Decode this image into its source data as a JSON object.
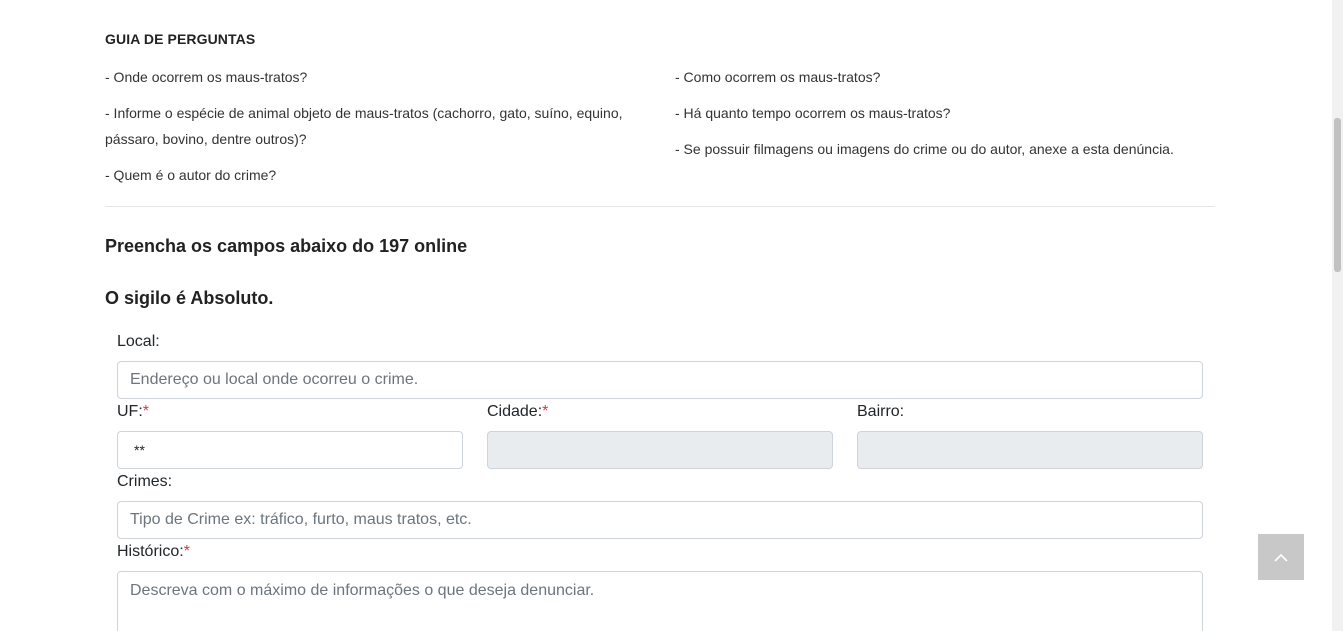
{
  "guide": {
    "title": "GUIA DE PERGUNTAS",
    "left": [
      "- Onde ocorrem os maus-tratos?",
      "- Informe o espécie de animal objeto de maus-tratos (cachorro, gato, suíno, equino, pássaro, bovino, dentre outros)?",
      "- Quem é o autor do crime?"
    ],
    "right": [
      "- Como ocorrem os maus-tratos?",
      "- Há quanto tempo ocorrem os maus-tratos?",
      "- Se possuir filmagens ou imagens do crime ou do autor, anexe a esta denúncia."
    ]
  },
  "headings": {
    "fill": "Preencha os campos abaixo do 197 online",
    "secrecy": "O sigilo é Absoluto."
  },
  "form": {
    "required_mark": "*",
    "local": {
      "label": "Local:",
      "value": "",
      "placeholder": "Endereço ou local onde ocorreu o crime."
    },
    "uf": {
      "label": "UF:",
      "value": "**"
    },
    "cidade": {
      "label": "Cidade:",
      "value": ""
    },
    "bairro": {
      "label": "Bairro:",
      "value": ""
    },
    "crimes": {
      "label": "Crimes:",
      "value": "",
      "placeholder": "Tipo de Crime ex: tráfico, furto, maus tratos, etc."
    },
    "historico": {
      "label": "Histórico:",
      "value": "",
      "placeholder": "Descreva com o máximo de informações o que deseja denunciar."
    }
  },
  "icons": {
    "back_to_top": "chevron-up-icon"
  },
  "colors": {
    "required": "#dc3545",
    "disabled_field": "#e9ecef",
    "back_to_top": "#c8c8c8"
  }
}
